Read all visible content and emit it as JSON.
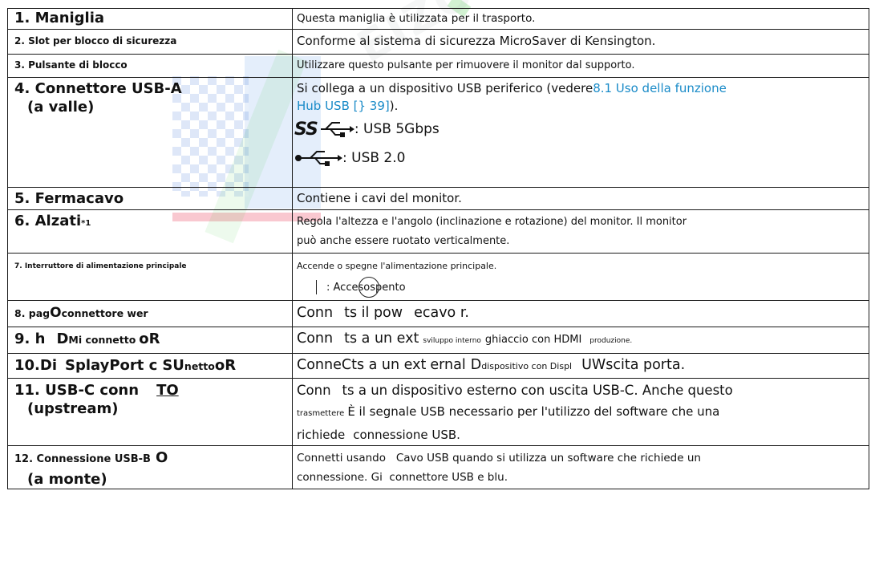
{
  "rows": [
    {
      "head": "1. Maniglia",
      "desc": "Questa maniglia è utilizzata per il trasporto."
    },
    {
      "head": "2. Slot per blocco di sicurezza",
      "desc": "Conforme al sistema di sicurezza MicroSaver di Kensington."
    },
    {
      "head": "3. Pulsante di blocco",
      "desc": "Utilizzare questo pulsante per rimuovere il monitor dal supporto."
    },
    {
      "head_line1": "4. Connettore USB-A",
      "head_line2": "(a valle)",
      "desc_pre": "Si collega a un dispositivo USB periferico (vedere",
      "desc_link1": "8.1 Uso della funzione",
      "desc_link2": "Hub USB [} 39]",
      "desc_post": ").",
      "ss_symbol": "SS",
      "ss_label": ": USB 5Gbps",
      "usb2_label": ": USB 2.0"
    },
    {
      "head": "5. Fermacavo",
      "desc": "Contiene i cavi del monitor."
    },
    {
      "head": "6. Alzati",
      "head_sup": "*1",
      "desc_line1": "Regola l'altezza e l'angolo (inclinazione e rotazione) del monitor. Il monitor",
      "desc_line2": "può anche essere ruotato verticalmente."
    },
    {
      "head": "7. Interruttore di alimentazione principale",
      "desc_line1": "Accende o spegne l'alimentazione principale.",
      "power_a": ": Acces",
      "power_b": "o",
      "power_c": " spento"
    },
    {
      "head_a": "8. pag",
      "head_b": "O",
      "head_c": "connettore wer",
      "desc_a": "Conn",
      "desc_b": "ts il pow",
      "desc_c": "ecavo r."
    },
    {
      "head_a": "9. h",
      "head_b": "D",
      "head_c": "Mi connetto",
      "head_d": "oR",
      "desc_a": "Conn",
      "desc_b": "ts a un ext",
      "desc_c": "sviluppo interno",
      "desc_d": "ghiaccio con HDMI",
      "desc_e": "produzione."
    },
    {
      "head_a": "10.Di",
      "head_b": "SplayPort c",
      "head_c": "SU",
      "head_d": "netto",
      "head_e": "oR",
      "desc_a": "ConneCts a un ext",
      "desc_b": "ernal",
      "desc_c": "D",
      "desc_d": "dispositivo con Displ",
      "desc_e": "UW",
      "desc_f": "scita porta."
    },
    {
      "head_a": "11. USB-C conn",
      "head_b": "TO",
      "head_line2": "(upstream)",
      "desc_a": "Conn",
      "desc_b": "ts a un dispositivo esterno con uscita USB-C. Anche questo",
      "desc_c": "trasmettere",
      "desc_d": "È il segnale USB necessario per l'utilizzo del software che una",
      "desc_e": "richiede",
      "desc_f": "connessione USB."
    },
    {
      "head_a": "12. Connessione USB-B",
      "head_b": "O",
      "head_line2": "(a monte)",
      "desc_line1": "Connetti usando   Cavo USB quando si utilizza un software che richiede un",
      "desc_line2": "connessione. Gi  connettore USB e blu."
    }
  ],
  "watermark": {
    "text": "EIZO",
    "accent_colors": [
      "#3b6fd6",
      "#ea3b55",
      "#4ccb4c"
    ]
  },
  "colors": {
    "link": "#1a8bc8",
    "border": "#1a1a1a"
  }
}
